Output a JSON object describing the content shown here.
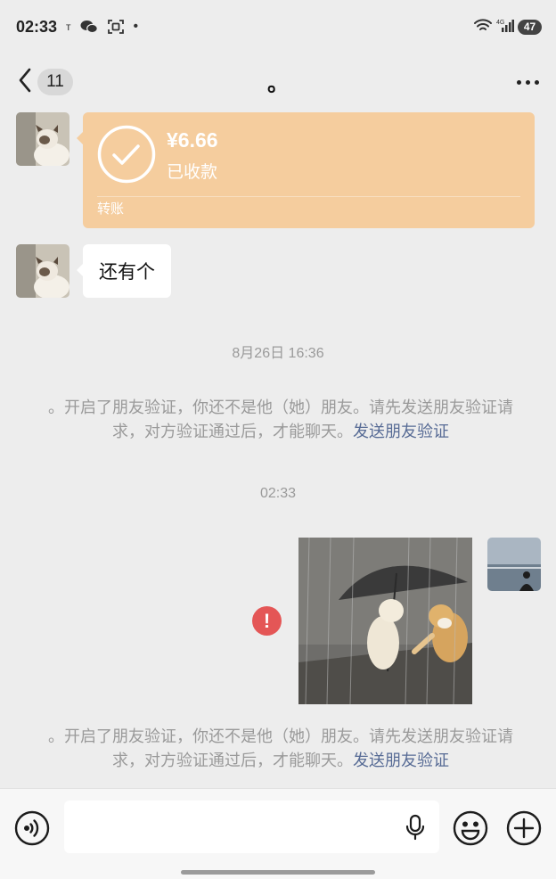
{
  "status_bar": {
    "time": "02:33",
    "small_indicator": "ᴛ",
    "dot": "•",
    "battery": "47",
    "signal_label": "4G"
  },
  "header": {
    "back_icon": "chevron-left-icon",
    "unread_count": "11",
    "title": "。",
    "more_icon": "more-dots-icon"
  },
  "messages": {
    "transfer": {
      "amount": "¥6.66",
      "status": "已收款",
      "label": "转账",
      "card_color": "#f5cd9e"
    },
    "text_message": "还有个",
    "timestamp_1": "8月26日 16:36",
    "notice_1": {
      "text": "。开启了朋友验证，你还不是他（她）朋友。请先发送朋友验证请求，对方验证通过后，才能聊天。",
      "link": "发送朋友验证"
    },
    "timestamp_2": "02:33",
    "notice_2": {
      "text": "。开启了朋友验证，你还不是他（她）朋友。请先发送朋友验证请求，对方验证通过后，才能聊天。",
      "link": "发送朋友验证"
    },
    "error_mark": "!"
  },
  "input_bar": {
    "voice_icon": "voice-mode-icon",
    "input_value": "",
    "mic_icon": "microphone-icon",
    "emoji_icon": "emoji-icon",
    "plus_icon": "plus-icon"
  },
  "colors": {
    "background": "#ededed",
    "link": "#576b95",
    "error": "#e45656"
  }
}
